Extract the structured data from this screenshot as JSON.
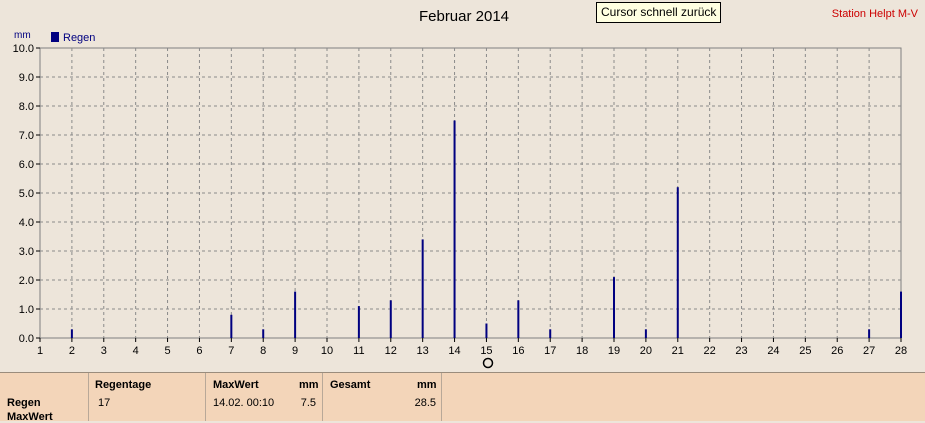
{
  "header": {
    "title": "Februar 2014",
    "station": "Station Helpt M-V",
    "unit": "mm",
    "tooltip": "Cursor schnell zurück"
  },
  "legend": {
    "label": "Regen",
    "color": "#000080"
  },
  "chart_data": {
    "type": "bar",
    "title": "Februar 2014",
    "ylabel": "mm",
    "xlabel": "",
    "ylim": [
      0,
      10
    ],
    "y_ticks": [
      "0.0",
      "1.0",
      "2.0",
      "3.0",
      "4.0",
      "5.0",
      "6.0",
      "7.0",
      "8.0",
      "9.0",
      "10.0"
    ],
    "x_ticks": [
      "1",
      "2",
      "3",
      "4",
      "5",
      "6",
      "7",
      "8",
      "9",
      "10",
      "11",
      "12",
      "13",
      "14",
      "15",
      "16",
      "17",
      "18",
      "19",
      "20",
      "21",
      "22",
      "23",
      "24",
      "25",
      "26",
      "27",
      "28"
    ],
    "grid": true,
    "legend_position": "top-left",
    "series": [
      {
        "name": "Regen",
        "color": "#000080",
        "points": [
          {
            "x": 2,
            "y": 0.3
          },
          {
            "x": 7,
            "y": 0.8
          },
          {
            "x": 8,
            "y": 0.3
          },
          {
            "x": 9,
            "y": 1.6
          },
          {
            "x": 11,
            "y": 1.1
          },
          {
            "x": 12,
            "y": 1.3
          },
          {
            "x": 13,
            "y": 3.4
          },
          {
            "x": 14,
            "y": 7.5
          },
          {
            "x": 15,
            "y": 0.5
          },
          {
            "x": 16,
            "y": 1.3
          },
          {
            "x": 17,
            "y": 0.3
          },
          {
            "x": 19,
            "y": 2.1
          },
          {
            "x": 20,
            "y": 0.3
          },
          {
            "x": 21,
            "y": 5.2
          },
          {
            "x": 27,
            "y": 0.3
          },
          {
            "x": 28,
            "y": 1.6
          }
        ]
      }
    ]
  },
  "stats": {
    "row1_label": "Regen",
    "row2_label": "MaxWert",
    "regentage_label": "Regentage",
    "regentage_value": "17",
    "maxwert_label": "MaxWert",
    "maxwert_unit": "mm",
    "maxwert_date": "14.02.  00:10",
    "maxwert_value": "7.5",
    "gesamt_label": "Gesamt",
    "gesamt_unit": "mm",
    "gesamt_value": "28.5"
  }
}
